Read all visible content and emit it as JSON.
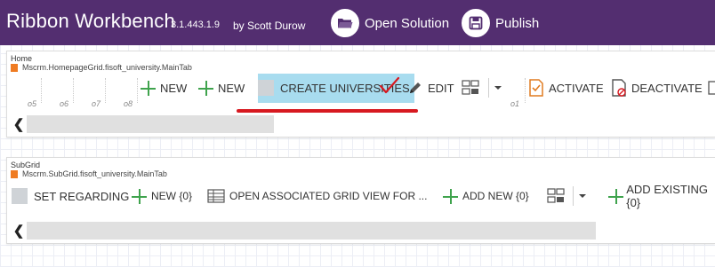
{
  "header": {
    "app_title": "Ribbon Workbench",
    "version": "3.1.443.1.9",
    "author": "by Scott Durow",
    "open_solution_label": "Open Solution",
    "publish_label": "Publish",
    "bg_color": "#532e70"
  },
  "home_ribbon": {
    "title": "Home",
    "tab_id": "Mscrm.HomepageGrid.fisoft_university.MainTab",
    "group_labels": [
      "o5",
      "o6",
      "o7",
      "o8",
      "o1"
    ],
    "buttons": {
      "new1": "NEW",
      "new2": "NEW",
      "create": "CREATE UNIVERSITIES",
      "edit": "EDIT",
      "activate": "ACTIVATE",
      "deactivate": "DEACTIVATE"
    }
  },
  "sub_ribbon": {
    "title": "SubGrid",
    "tab_id": "Mscrm.SubGrid.fisoft_university.MainTab",
    "buttons": {
      "set_regarding": "SET REGARDING",
      "new": "NEW {0}",
      "open_associated": "OPEN ASSOCIATED GRID VIEW FOR ...",
      "add_new": "ADD NEW {0}",
      "add_existing": "ADD EXISTING {0}"
    }
  },
  "annotation": {
    "highlight_color": "#a8dcef",
    "underline_color": "#d71920",
    "check_color": "#d71920"
  }
}
